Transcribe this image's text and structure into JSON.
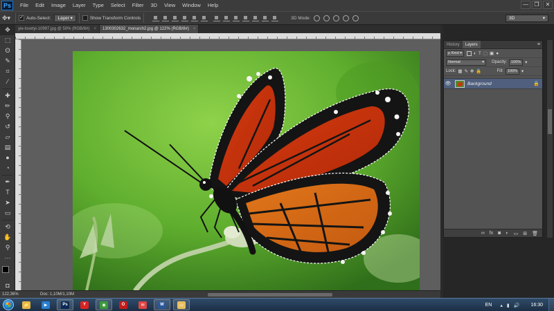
{
  "app": {
    "logo": "Ps"
  },
  "menu": [
    "File",
    "Edit",
    "Image",
    "Layer",
    "Type",
    "Select",
    "Filter",
    "3D",
    "View",
    "Window",
    "Help"
  ],
  "window_controls": {
    "minimize": "—",
    "restore": "❐",
    "close": "✕"
  },
  "options": {
    "auto_select_label": "Auto-Select:",
    "auto_select_checked": true,
    "auto_select_target": "Layer",
    "show_transform_label": "Show Transform Controls",
    "show_transform_checked": false,
    "mode_3d_label": "3D Mode:",
    "workspace": "3D"
  },
  "documents": [
    {
      "title": "yie-tsvetyi-10997.jpg @ 50% (RGB/8#)",
      "active": false
    },
    {
      "title": "1300302632_monarch2.jpg @ 122% (RGB/8#)",
      "active": true
    }
  ],
  "status": {
    "zoom": "122,36%",
    "doc_info": "Doc: 1,10M/1,10M"
  },
  "layers_panel": {
    "tabs": [
      {
        "label": "History",
        "active": false
      },
      {
        "label": "Layers",
        "active": true
      }
    ],
    "filter_label": "ρ Kind",
    "blend_mode": "Normal",
    "opacity_label": "Opacity:",
    "opacity_value": "100%",
    "lock_label": "Lock:",
    "fill_label": "Fill:",
    "fill_value": "100%",
    "layers": [
      {
        "name": "Background",
        "visible": true,
        "locked": true,
        "selected": true
      }
    ]
  },
  "taskbar": {
    "apps": [
      {
        "name": "windows-explorer",
        "label": "📁",
        "color": "#e8b84a",
        "open": false
      },
      {
        "name": "media-player",
        "label": "▶",
        "color": "#2a7fd0",
        "open": false
      },
      {
        "name": "photoshop",
        "label": "Ps",
        "color": "#0b2a55",
        "open": true
      },
      {
        "name": "yandex-browser",
        "label": "Y",
        "color": "#d22",
        "open": false
      },
      {
        "name": "chrome",
        "label": "◉",
        "color": "#3b9a3b",
        "open": true
      },
      {
        "name": "opera",
        "label": "O",
        "color": "#c41c1c",
        "open": false
      },
      {
        "name": "app-red",
        "label": "✉",
        "color": "#d44",
        "open": false
      },
      {
        "name": "word",
        "label": "W",
        "color": "#2b5797",
        "open": true
      },
      {
        "name": "folder",
        "label": "▭",
        "color": "#e8c060",
        "open": true
      }
    ],
    "language": "EN",
    "clock": "16:30"
  }
}
